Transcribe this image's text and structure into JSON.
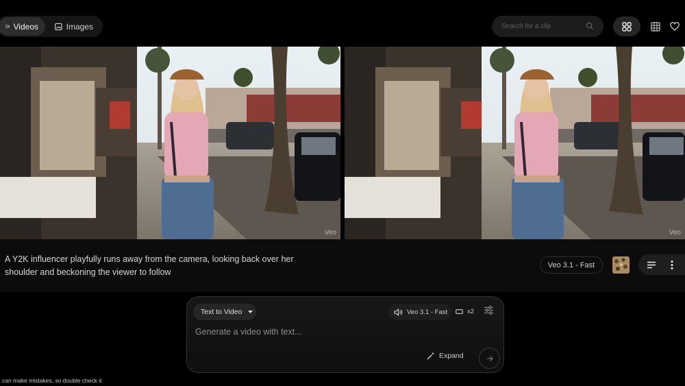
{
  "tabs": {
    "videos_label": "Videos",
    "images_label": "Images",
    "active": "videos"
  },
  "search": {
    "placeholder": "Search for a clip"
  },
  "view_modes": [
    "grid-large",
    "grid-small",
    "favorites"
  ],
  "result": {
    "watermark": "Veo",
    "prompt": "A Y2K influencer playfully runs away from the camera, looking back over her shoulder and beckoning the viewer to follow",
    "model": "Veo 3.1 - Fast"
  },
  "composer": {
    "mode_label": "Text to Video",
    "model_label": "Veo 3.1 - Fast",
    "count_label": "x2",
    "placeholder": "Generate a video with text...",
    "expand_label": "Expand"
  },
  "disclaimer": "can make mistakes, so double check it",
  "colors": {
    "background": "#000000",
    "panel": "#0c0c0c",
    "chip": "#262626"
  }
}
